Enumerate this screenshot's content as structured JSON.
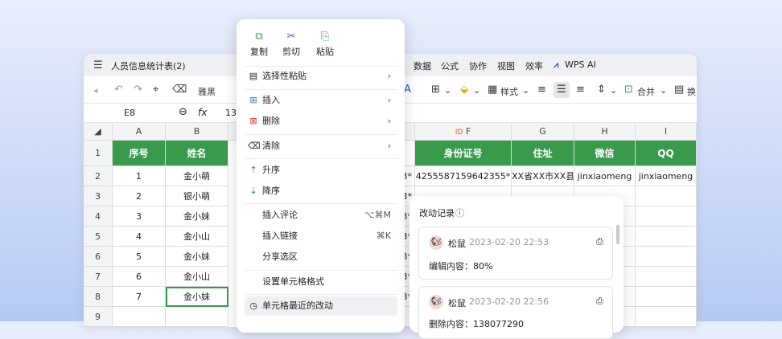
{
  "window": {
    "title": "人员信息统计表(2)",
    "menus": [
      "数据",
      "公式",
      "协作",
      "视图",
      "效率",
      "WPS AI"
    ]
  },
  "toolbar": {
    "font": "雅黑",
    "style_label": "样式",
    "merge_label": "合并",
    "wrap_label": "换"
  },
  "formula_bar": {
    "cell_ref": "E8",
    "fx": "fx",
    "value": "13"
  },
  "columns": [
    "A",
    "B",
    "F",
    "G",
    "H",
    "I"
  ],
  "header_row": [
    "序号",
    "姓名",
    "身份证号",
    "住址",
    "微信",
    "QQ"
  ],
  "rows": [
    {
      "n": "1",
      "a": "序号",
      "b": "姓名",
      "f": "身份证号",
      "g": "住址",
      "h": "微信",
      "i": "QQ"
    },
    {
      "n": "2",
      "a": "1",
      "b": "金小萌",
      "e_tail": "3*",
      "f": "4255587159642355*",
      "g": "XX省XX市XX县",
      "h": "jinxiaomeng",
      "i": "jinxiaomeng"
    },
    {
      "n": "3",
      "a": "2",
      "b": "银小萌",
      "e_tail": "3*"
    },
    {
      "n": "4",
      "a": "3",
      "b": "金小妹",
      "e_tail": "3*"
    },
    {
      "n": "5",
      "a": "4",
      "b": "金小山",
      "e_tail": "3*"
    },
    {
      "n": "6",
      "a": "5",
      "b": "金小妹",
      "e_tail": "3*"
    },
    {
      "n": "7",
      "a": "6",
      "b": "金小山",
      "e_tail": "3*"
    },
    {
      "n": "8",
      "a": "7",
      "b": "金小妹",
      "e_tail": "3*"
    },
    {
      "n": "9",
      "a": "",
      "b": "",
      "e_tail": ""
    }
  ],
  "context_menu": {
    "top": [
      {
        "icon": "copy-icon",
        "label": "复制"
      },
      {
        "icon": "cut-icon",
        "label": "剪切"
      },
      {
        "icon": "paste-icon",
        "label": "粘贴"
      }
    ],
    "items": [
      {
        "label": "选择性粘贴",
        "right": "›"
      },
      {
        "label": "插入",
        "right": "›"
      },
      {
        "label": "删除",
        "right": "›"
      },
      {
        "label": "清除",
        "right": "›"
      },
      {
        "label": "升序",
        "right": ""
      },
      {
        "label": "降序",
        "right": ""
      },
      {
        "label": "插入评论",
        "right": "⌥⌘M"
      },
      {
        "label": "插入链接",
        "right": "⌘K"
      },
      {
        "label": "分享选区",
        "right": ""
      },
      {
        "label": "设置单元格格式",
        "right": ""
      },
      {
        "label": "单元格最近的改动",
        "right": ""
      }
    ]
  },
  "change_panel": {
    "title": "改动记录",
    "records": [
      {
        "user": "松鼠",
        "time": "2023-02-20 22:53",
        "content": "编辑内容：80%"
      },
      {
        "user": "松鼠",
        "time": "2023-02-20 22:56",
        "content": "删除内容：138077290"
      }
    ]
  }
}
